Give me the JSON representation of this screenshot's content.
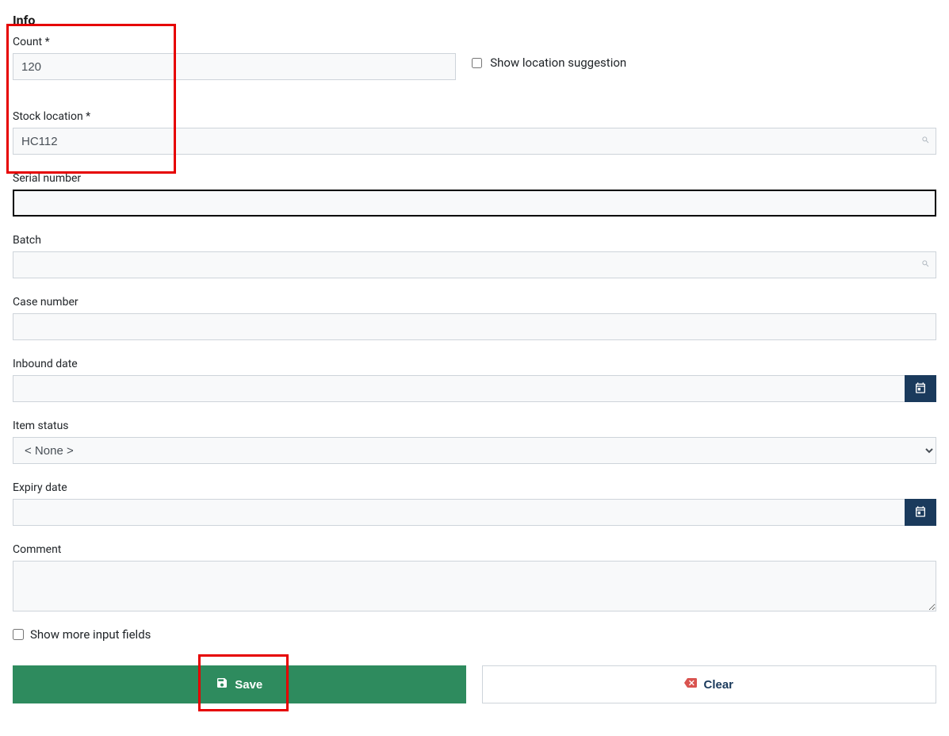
{
  "section_title": "Info",
  "fields": {
    "count": {
      "label": "Count *",
      "value": "120"
    },
    "show_location_suggestion": {
      "label": "Show location suggestion",
      "checked": false
    },
    "stock_location": {
      "label": "Stock location *",
      "value": "HC112"
    },
    "serial_number": {
      "label": "Serial number",
      "value": ""
    },
    "batch": {
      "label": "Batch",
      "value": ""
    },
    "case_number": {
      "label": "Case number",
      "value": ""
    },
    "inbound_date": {
      "label": "Inbound date",
      "value": ""
    },
    "item_status": {
      "label": "Item status",
      "value": "< None >"
    },
    "expiry_date": {
      "label": "Expiry date",
      "value": ""
    },
    "comment": {
      "label": "Comment",
      "value": ""
    },
    "show_more": {
      "label": "Show more input fields",
      "checked": false
    }
  },
  "buttons": {
    "save": "Save",
    "clear": "Clear"
  }
}
